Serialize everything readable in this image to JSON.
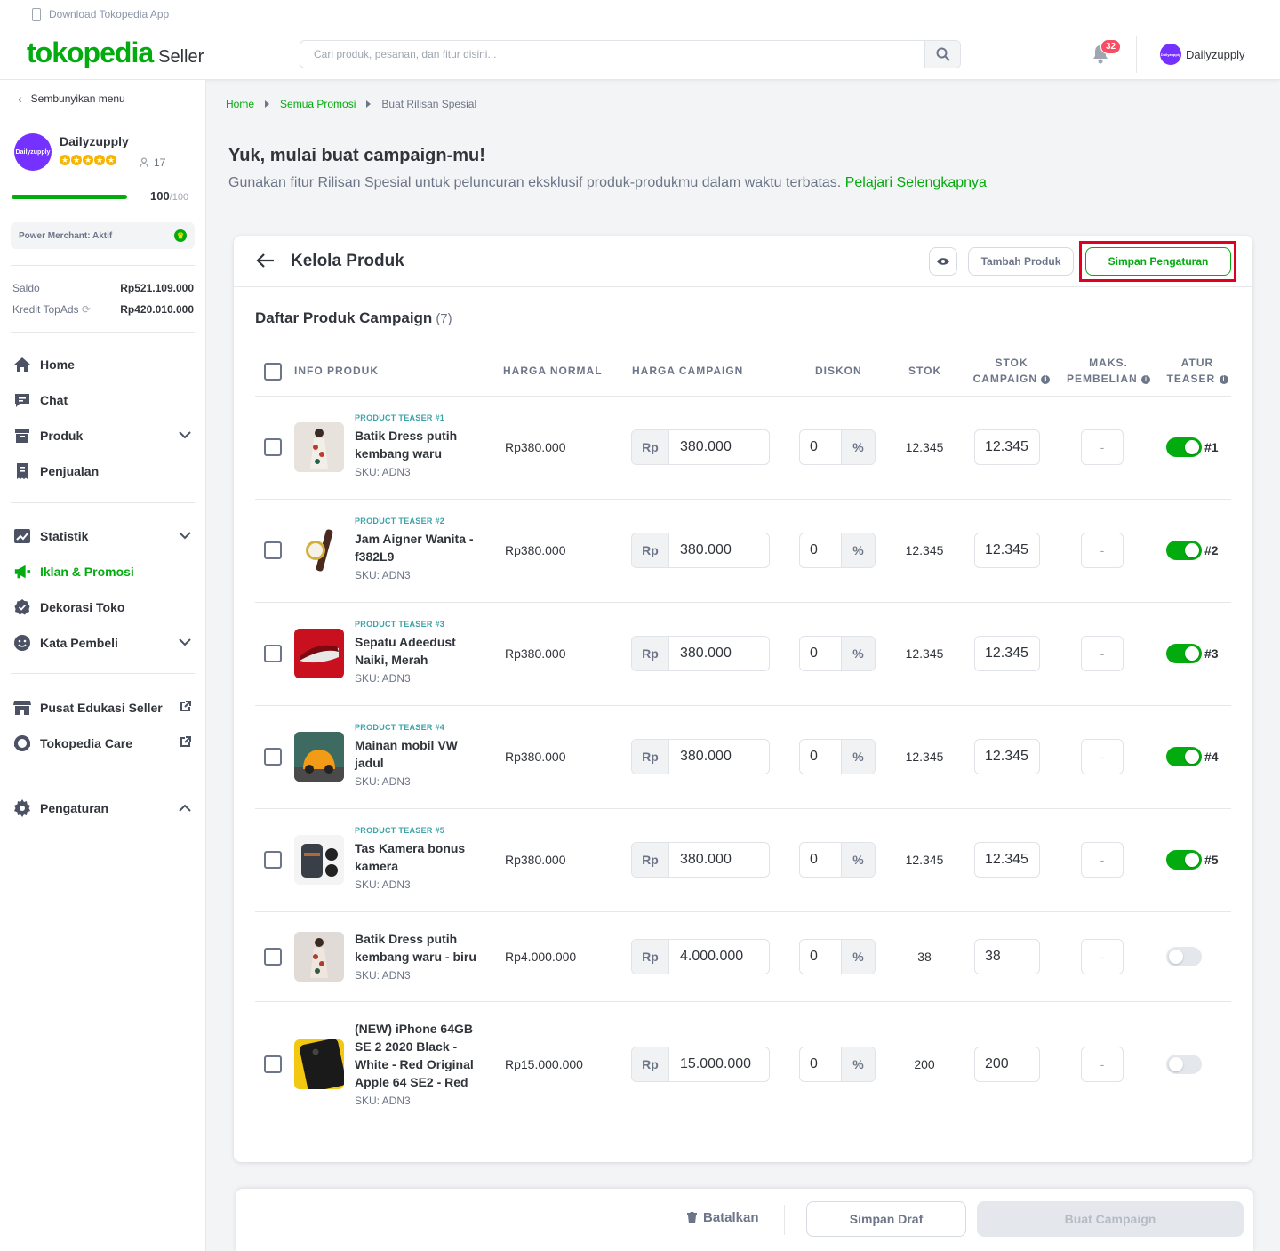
{
  "topbar": {
    "download_app": "Download Tokopedia App"
  },
  "header": {
    "logo": "tokopedia",
    "logo_sub": "Seller",
    "search_placeholder": "Cari produk, pesanan, dan fitur disini...",
    "notif_count": "32",
    "user_name": "Dailyzupply",
    "avatar_text": "Dailyzupply"
  },
  "sidebar": {
    "hide_menu": "Sembunyikan menu",
    "shop_name": "Dailyzupply",
    "shop_avatar": "Dailyzupply",
    "followers": "17",
    "score": "100",
    "score_max": "/100",
    "power_merchant": "Power Merchant: Aktif",
    "saldo_label": "Saldo",
    "saldo_value": "Rp521.109.000",
    "topads_label": "Kredit TopAds",
    "topads_value": "Rp420.010.000",
    "nav": {
      "home": "Home",
      "chat": "Chat",
      "produk": "Produk",
      "penjualan": "Penjualan",
      "statistik": "Statistik",
      "iklan": "Iklan & Promosi",
      "dekorasi": "Dekorasi Toko",
      "kata_pembeli": "Kata Pembeli",
      "pusat_edukasi": "Pusat Edukasi Seller",
      "tokopedia_care": "Tokopedia Care",
      "pengaturan": "Pengaturan"
    }
  },
  "breadcrumb": {
    "home": "Home",
    "semua_promosi": "Semua Promosi",
    "current": "Buat Rilisan Spesial"
  },
  "intro": {
    "title": "Yuk, mulai buat campaign-mu!",
    "desc": "Gunakan fitur Rilisan Spesial untuk peluncuran eksklusif produk-produkmu dalam waktu terbatas.",
    "link": "Pelajari Selengkapnya"
  },
  "card": {
    "title": "Kelola Produk",
    "add_product": "Tambah Produk",
    "save_settings": "Simpan Pengaturan",
    "list_title": "Daftar Produk Campaign",
    "list_count": "(7)"
  },
  "table": {
    "headers": {
      "info": "INFO PRODUK",
      "normal": "HARGA NORMAL",
      "campaign": "HARGA CAMPAIGN",
      "diskon": "DISKON",
      "stok": "STOK",
      "stok_campaign_1": "STOK",
      "stok_campaign_2": "CAMPAIGN",
      "maks_1": "MAKS.",
      "maks_2": "PEMBELIAN",
      "teaser_1": "ATUR",
      "teaser_2": "TEASER"
    },
    "currency_prefix": "Rp",
    "percent_suffix": "%",
    "rows": [
      {
        "teaser_label": "PRODUCT TEASER #1",
        "name": "Batik Dress putih kembang waru",
        "sku": "SKU: ADN3",
        "normal_price": "Rp380.000",
        "campaign_price": "380.000",
        "discount": "0",
        "stock": "12.345",
        "campaign_stock": "12.345",
        "max_purchase": "-",
        "teaser_on": true,
        "teaser_num": "#1"
      },
      {
        "teaser_label": "PRODUCT TEASER #2",
        "name": "Jam Aigner Wanita - f382L9",
        "sku": "SKU: ADN3",
        "normal_price": "Rp380.000",
        "campaign_price": "380.000",
        "discount": "0",
        "stock": "12.345",
        "campaign_stock": "12.345",
        "max_purchase": "-",
        "teaser_on": true,
        "teaser_num": "#2"
      },
      {
        "teaser_label": "PRODUCT TEASER #3",
        "name": "Sepatu Adeedust Naiki, Merah",
        "sku": "SKU: ADN3",
        "normal_price": "Rp380.000",
        "campaign_price": "380.000",
        "discount": "0",
        "stock": "12.345",
        "campaign_stock": "12.345",
        "max_purchase": "-",
        "teaser_on": true,
        "teaser_num": "#3"
      },
      {
        "teaser_label": "PRODUCT TEASER #4",
        "name": "Mainan mobil VW jadul",
        "sku": "SKU: ADN3",
        "normal_price": "Rp380.000",
        "campaign_price": "380.000",
        "discount": "0",
        "stock": "12.345",
        "campaign_stock": "12.345",
        "max_purchase": "-",
        "teaser_on": true,
        "teaser_num": "#4"
      },
      {
        "teaser_label": "PRODUCT TEASER #5",
        "name": "Tas Kamera bonus kamera",
        "sku": "SKU: ADN3",
        "normal_price": "Rp380.000",
        "campaign_price": "380.000",
        "discount": "0",
        "stock": "12.345",
        "campaign_stock": "12.345",
        "max_purchase": "-",
        "teaser_on": true,
        "teaser_num": "#5"
      },
      {
        "teaser_label": "",
        "name": "Batik Dress putih kembang waru - biru",
        "sku": "SKU: ADN3",
        "normal_price": "Rp4.000.000",
        "campaign_price": "4.000.000",
        "discount": "0",
        "stock": "38",
        "campaign_stock": "38",
        "max_purchase": "-",
        "teaser_on": false,
        "teaser_num": ""
      },
      {
        "teaser_label": "",
        "name": "(NEW) iPhone 64GB SE 2 2020 Black - White - Red Original Apple 64 SE2 - Red",
        "sku": "SKU: ADN3",
        "normal_price": "Rp15.000.000",
        "campaign_price": "15.000.000",
        "discount": "0",
        "stock": "200",
        "campaign_stock": "200",
        "max_purchase": "-",
        "teaser_on": false,
        "teaser_num": ""
      }
    ]
  },
  "footer": {
    "cancel": "Batalkan",
    "save_draft": "Simpan Draf",
    "create": "Buat Campaign"
  },
  "colors": {
    "brand": "#03ac0e",
    "highlight": "#e1001f",
    "notif": "#f94d63",
    "avatar": "#7431ff"
  },
  "icons": [
    "phone-icon",
    "search-icon",
    "bell-icon",
    "chevron-left-icon",
    "home-icon",
    "chat-icon",
    "box-icon",
    "receipt-icon",
    "chart-icon",
    "megaphone-icon",
    "badge-icon",
    "smile-icon",
    "store-icon",
    "headset-icon",
    "gear-icon",
    "external-link-icon",
    "eye-icon",
    "arrow-left-icon",
    "trash-icon",
    "info-icon"
  ]
}
